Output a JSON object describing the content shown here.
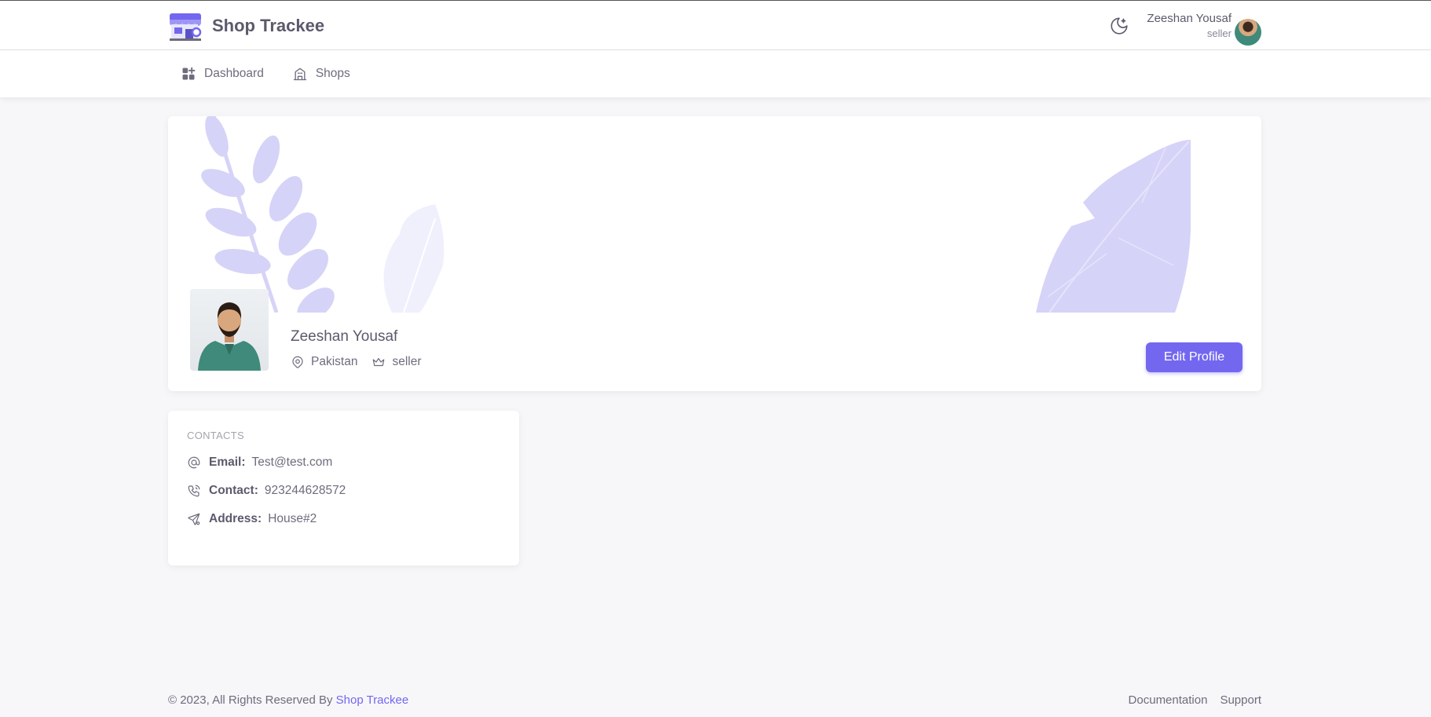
{
  "app": {
    "name": "Shop Trackee"
  },
  "header": {
    "user_name": "Zeeshan Yousaf",
    "user_role": "seller",
    "theme_icon": "moon-stars-icon"
  },
  "nav": {
    "items": [
      {
        "label": "Dashboard",
        "icon": "dashboard-icon"
      },
      {
        "label": "Shops",
        "icon": "building-icon"
      }
    ]
  },
  "profile": {
    "name": "Zeeshan Yousaf",
    "location": "Pakistan",
    "role": "seller",
    "edit_label": "Edit Profile"
  },
  "contacts": {
    "heading": "Contacts",
    "items": [
      {
        "label": "Email:",
        "value": "Test@test.com",
        "icon": "at-icon"
      },
      {
        "label": "Contact:",
        "value": "923244628572",
        "icon": "phone-call-icon"
      },
      {
        "label": "Address:",
        "value": "House#2",
        "icon": "send-icon"
      }
    ]
  },
  "footer": {
    "copyright": "© 2023, All Rights Reserved By ",
    "brand_link": "Shop Trackee",
    "links": [
      "Documentation",
      "Support"
    ]
  },
  "colors": {
    "primary": "#7367f0",
    "text": "#5d596c",
    "background": "#f7f7f9"
  }
}
